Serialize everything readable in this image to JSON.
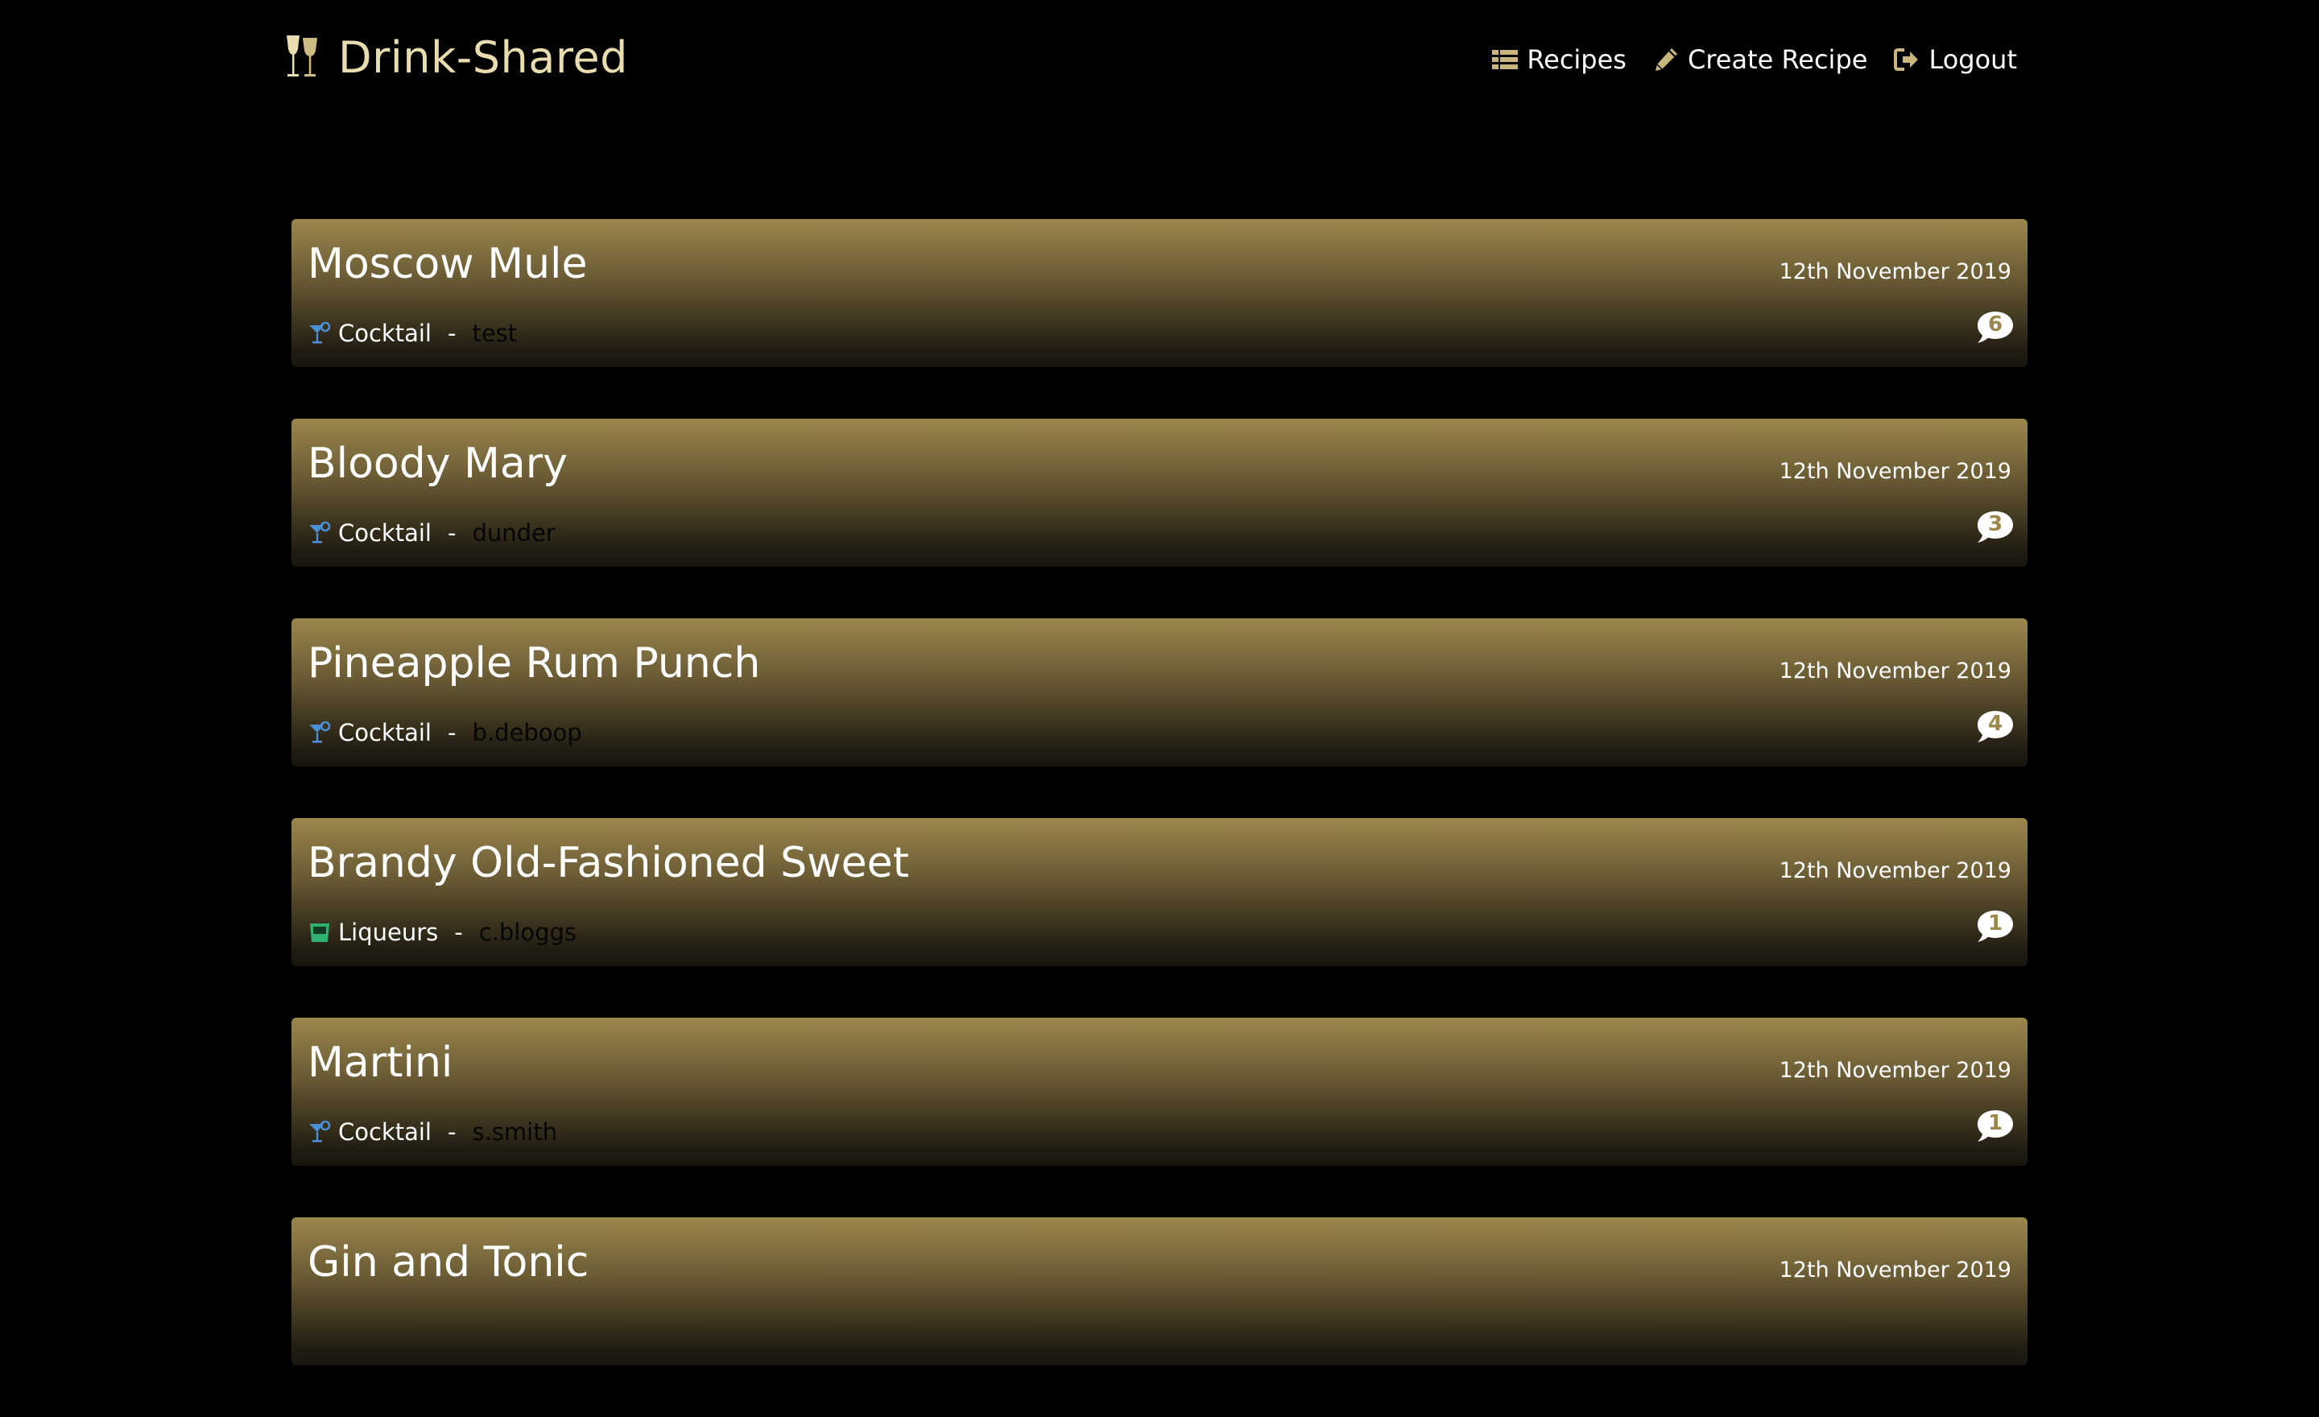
{
  "brand": {
    "name": "Drink-Shared",
    "logo_icon": "wine-glasses-icon"
  },
  "nav": [
    {
      "label": "Recipes",
      "icon": "list-icon"
    },
    {
      "label": "Create Recipe",
      "icon": "pencil-icon"
    },
    {
      "label": "Logout",
      "icon": "sign-out-icon"
    }
  ],
  "colors": {
    "background": "#000000",
    "brand_text": "#e9dcae",
    "accent_gold": "#9b874e",
    "cocktail_icon": "#4a90d9",
    "liqueur_icon": "#2db36f"
  },
  "recipes": [
    {
      "title": "Moscow Mule",
      "date": "12th November 2019",
      "category": "Cocktail",
      "category_icon": "cocktail-icon",
      "separator": "-",
      "author": "test",
      "comments": "6"
    },
    {
      "title": "Bloody Mary",
      "date": "12th November 2019",
      "category": "Cocktail",
      "category_icon": "cocktail-icon",
      "separator": "-",
      "author": "dunder",
      "comments": "3"
    },
    {
      "title": "Pineapple Rum Punch",
      "date": "12th November 2019",
      "category": "Cocktail",
      "category_icon": "cocktail-icon",
      "separator": "-",
      "author": "b.deboop",
      "comments": "4"
    },
    {
      "title": "Brandy Old-Fashioned Sweet",
      "date": "12th November 2019",
      "category": "Liqueurs",
      "category_icon": "tumbler-glass-icon",
      "separator": "-",
      "author": "c.bloggs",
      "comments": "1"
    },
    {
      "title": "Martini",
      "date": "12th November 2019",
      "category": "Cocktail",
      "category_icon": "cocktail-icon",
      "separator": "-",
      "author": "s.smith",
      "comments": "1"
    },
    {
      "title": "Gin and Tonic",
      "date": "12th November 2019"
    }
  ]
}
